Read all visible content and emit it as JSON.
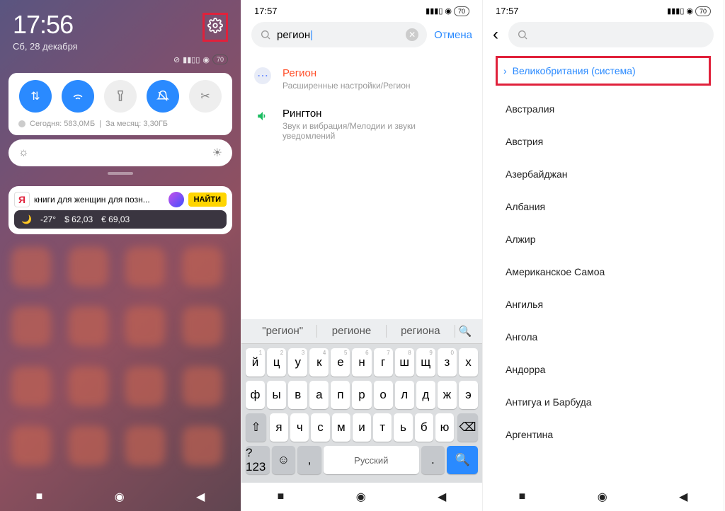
{
  "phone1": {
    "time": "17:56",
    "date": "Сб, 28 декабря",
    "battery": "70",
    "usage_today": "Сегодня: 583,0МБ",
    "usage_month": "За месяц: 3,30ГБ",
    "yandex_text": "книги для женщин для позн...",
    "yandex_find": "НАЙТИ",
    "temp": "-27°",
    "usd": "$ 62,03",
    "eur": "€ 69,03"
  },
  "phone2": {
    "time": "17:57",
    "battery": "70",
    "search_value": "регион",
    "cancel": "Отмена",
    "results": [
      {
        "title": "Регион",
        "sub": "Расширенные настройки/Регион",
        "hi": true
      },
      {
        "title": "Рингтон",
        "sub": "Звук и вибрация/Мелодии и звуки уведомлений",
        "hi": false
      }
    ],
    "suggestions": [
      "\"регион\"",
      "регионе",
      "региона"
    ],
    "rows": [
      [
        "й",
        "ц",
        "у",
        "к",
        "е",
        "н",
        "г",
        "ш",
        "щ",
        "з",
        "х"
      ],
      [
        "ф",
        "ы",
        "в",
        "а",
        "п",
        "р",
        "о",
        "л",
        "д",
        "ж",
        "э"
      ]
    ],
    "row3": [
      "я",
      "ч",
      "с",
      "м",
      "и",
      "т",
      "ь",
      "б",
      "ю"
    ],
    "sym": "?123",
    "space": "Русский"
  },
  "phone3": {
    "time": "17:57",
    "battery": "70",
    "current": "Великобритания (система)",
    "regions": [
      "Австралия",
      "Австрия",
      "Азербайджан",
      "Албания",
      "Алжир",
      "Американское Самоа",
      "Ангилья",
      "Ангола",
      "Андорра",
      "Антигуа и Барбуда",
      "Аргентина"
    ]
  }
}
